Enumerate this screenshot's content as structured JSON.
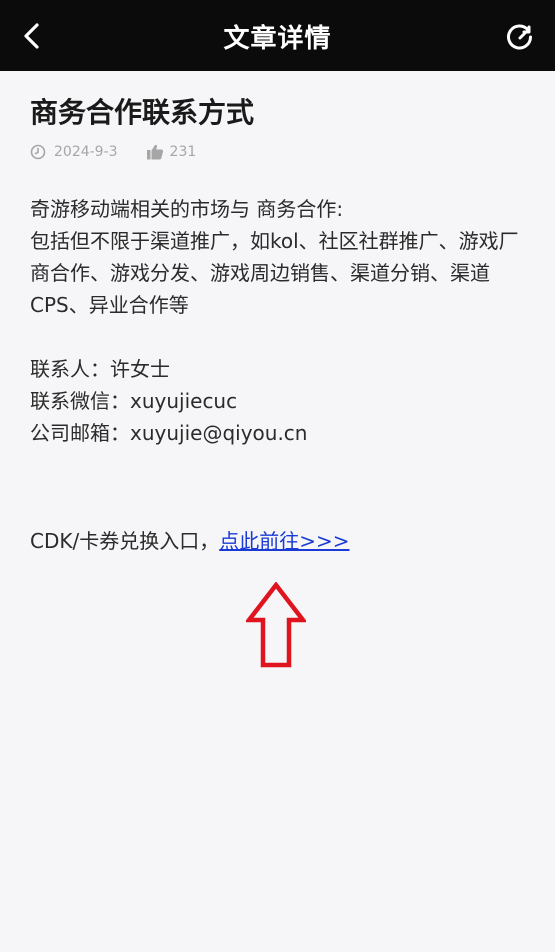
{
  "header": {
    "title": "文章详情"
  },
  "icons": {
    "back": "back-arrow-icon",
    "refresh": "refresh-icon",
    "date": "clock-icon",
    "like": "thumbs-up-icon",
    "annotation": "up-arrow-icon"
  },
  "article": {
    "title": "商务合作联系方式",
    "date": "2024-9-3",
    "likes": "231",
    "paragraph1": "奇游移动端相关的市场与 商务合作:",
    "paragraph2": "包括但不限于渠道推广，如kol、社区社群推广、游戏厂商合作、游戏分发、游戏周边销售、渠道分销、渠道CPS、异业合作等",
    "contact_person": "联系人：许女士",
    "contact_wechat": "联系微信：xuyujiecuc",
    "contact_email": "公司邮箱：xuyujie@qiyou.cn",
    "cdk_prefix": "CDK/卡券兑换入口，",
    "cdk_link": "点此前往>>>"
  },
  "colors": {
    "header_bg": "#0b0b0b",
    "page_bg": "#f6f6f8",
    "link": "#1a3ad6",
    "annotation_arrow": "#e0141e"
  }
}
